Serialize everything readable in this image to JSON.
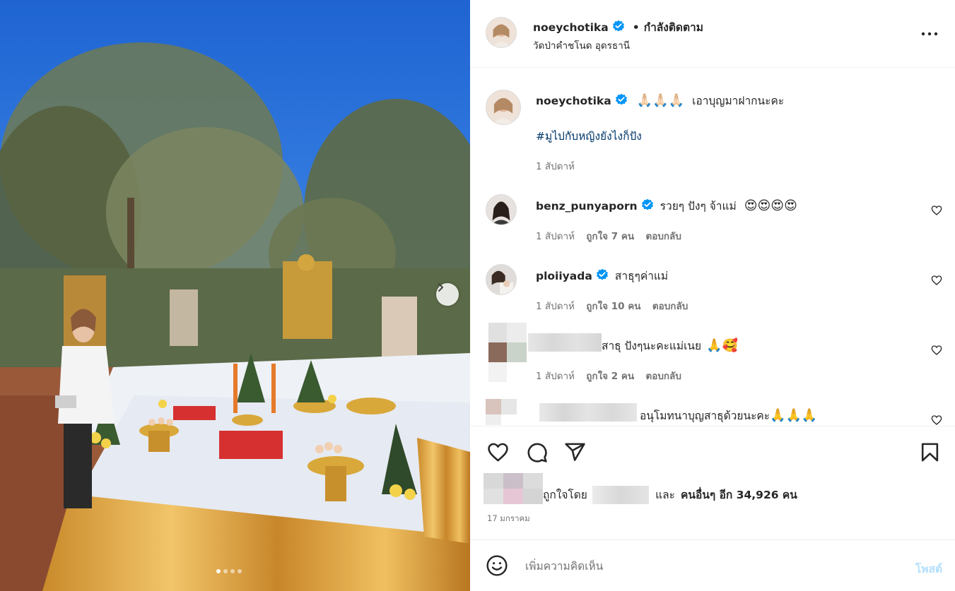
{
  "header": {
    "username": "noeychotika",
    "separator": "•",
    "follow_status": "กำลังติดตาม",
    "location": "วัดป่าคำชโนด อุดรธานี",
    "more_icon": "more-horizontal-icon"
  },
  "caption": {
    "username": "noeychotika",
    "emojis": "🙏🏻🙏🏻🙏🏻",
    "text": "เอาบุญมาฝากนะคะ",
    "hashtag": "#มูไปกับหญิงยังไงก็ปัง",
    "time": "1 สัปดาห์"
  },
  "comments": [
    {
      "username": "benz_punyaporn",
      "text": "รวยๆ ปังๆ จ้าแม่",
      "emojis": "😍😍😍😍",
      "time": "1 สัปดาห์",
      "likes": "ถูกใจ 7 คน",
      "reply": "ตอบกลับ"
    },
    {
      "username": "ploiiyada",
      "text": "สาธุๆค่าแม่",
      "emojis": "",
      "time": "1 สัปดาห์",
      "likes": "ถูกใจ 10 คน",
      "reply": "ตอบกลับ"
    },
    {
      "username": "",
      "text": "สาธุ ปังๆนะคะแม่เนย",
      "emojis": "🙏🥰",
      "time": "1 สัปดาห์",
      "likes": "ถูกใจ 2 คน",
      "reply": "ตอบกลับ"
    },
    {
      "username": "",
      "text": "อนุโมทนาบุญสาธุด้วยนะคะ",
      "emojis": "🙏🙏🙏",
      "time": "",
      "likes": "",
      "reply": ""
    }
  ],
  "likes": {
    "prefix": "ถูกใจโดย",
    "and": "และ",
    "others": "คนอื่นๆ อีก 34,926 คน"
  },
  "date": "17 มกราคม",
  "add_comment": {
    "placeholder": "เพิ่มความคิดเห็น",
    "post_label": "โพสต์"
  },
  "carousel": {
    "slide_count": 4,
    "current_slide": 1
  },
  "colors": {
    "verified": "#0095f6",
    "link": "#00376b",
    "post_disabled": "#b2dffc",
    "muted": "#737373"
  }
}
